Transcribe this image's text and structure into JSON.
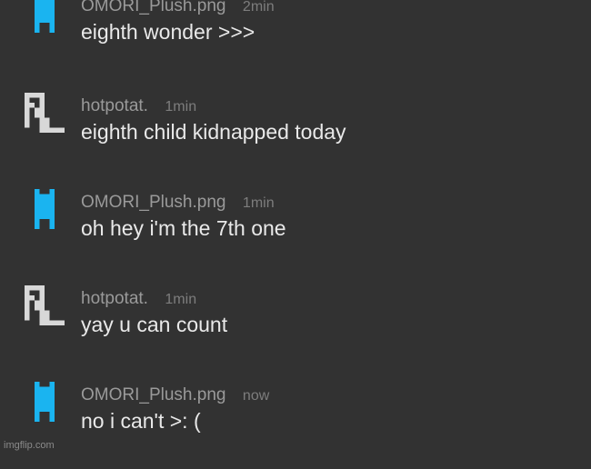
{
  "messages": [
    {
      "author": "OMORI_Plush.png",
      "time": "2min",
      "text": "eighth wonder >>>",
      "avatar": "blue-pixel-avatar-icon",
      "color": "#1ab4f0"
    },
    {
      "author": "hotpotat.",
      "time": "1min",
      "text": "eighth child kidnapped today",
      "avatar": "white-pixel-avatar-icon",
      "color": "#d8d8d8"
    },
    {
      "author": "OMORI_Plush.png",
      "time": "1min",
      "text": "oh hey i'm the 7th one",
      "avatar": "blue-pixel-avatar-icon",
      "color": "#1ab4f0"
    },
    {
      "author": "hotpotat.",
      "time": "1min",
      "text": "yay u can count",
      "avatar": "white-pixel-avatar-icon",
      "color": "#d8d8d8"
    },
    {
      "author": "OMORI_Plush.png",
      "time": "now",
      "text": "no i can't >: (",
      "avatar": "blue-pixel-avatar-icon",
      "color": "#1ab4f0"
    }
  ],
  "watermark": "imgflip.com"
}
